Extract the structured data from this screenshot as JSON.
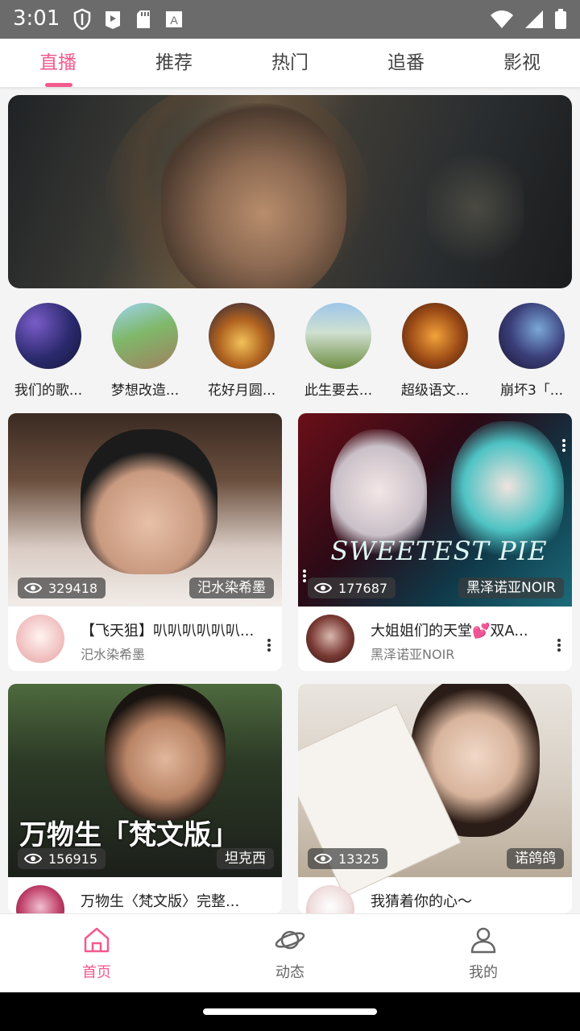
{
  "status_bar": {
    "time": "3:01"
  },
  "tabs": [
    {
      "label": "直播",
      "active": true
    },
    {
      "label": "推荐",
      "active": false
    },
    {
      "label": "热门",
      "active": false
    },
    {
      "label": "追番",
      "active": false
    },
    {
      "label": "影视",
      "active": false
    }
  ],
  "channels": [
    {
      "label": "我们的歌..."
    },
    {
      "label": "梦想改造..."
    },
    {
      "label": "花好月圆..."
    },
    {
      "label": "此生要去..."
    },
    {
      "label": "超级语文..."
    },
    {
      "label": "崩坏3「..."
    }
  ],
  "cards": [
    {
      "views": "329418",
      "host_tag": "汜水染希墨",
      "title": "【飞天狙】叭叭叭叭叭叭...",
      "host": "汜水染希墨"
    },
    {
      "views": "177687",
      "host_tag": "黑泽诺亚NOIR",
      "title": "大姐姐们的天堂💕双A...",
      "host": "黑泽诺亚NOIR",
      "thumb_text": "SWEETEST PIE"
    },
    {
      "views": "156915",
      "host_tag": "坦克西",
      "title": "万物生〈梵文版〉完整...",
      "host": "",
      "thumb_text": "万物生「梵文版」"
    },
    {
      "views": "13325",
      "host_tag": "诺鸽鸽",
      "title": "我猜着你的心～",
      "host": ""
    }
  ],
  "bottom_nav": [
    {
      "label": "首页",
      "icon": "home-icon",
      "active": true
    },
    {
      "label": "动态",
      "icon": "planet-icon",
      "active": false
    },
    {
      "label": "我的",
      "icon": "person-icon",
      "active": false
    }
  ],
  "colors": {
    "accent": "#f45a8d",
    "status_bar": "#6b6b6b"
  }
}
